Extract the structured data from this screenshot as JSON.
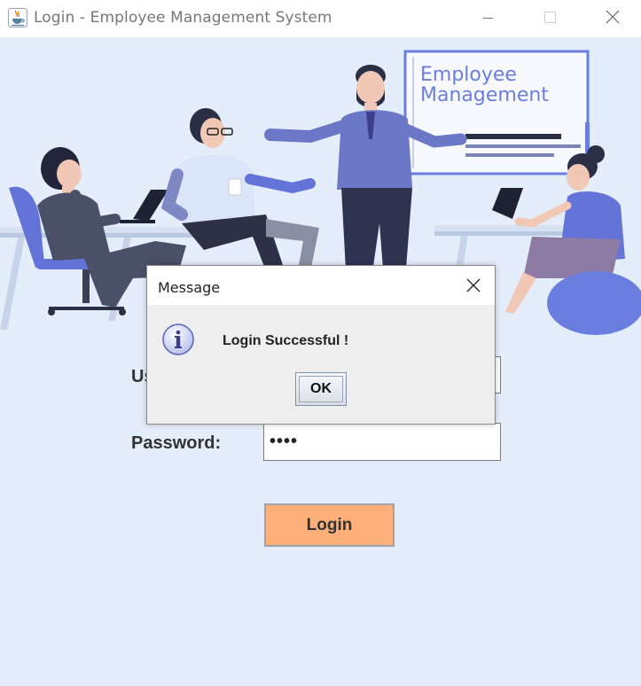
{
  "window": {
    "title": "Login - Employee Management System",
    "icon": "java-cup-icon"
  },
  "illustration": {
    "board_line1": "Employee",
    "board_line2": "Management"
  },
  "form": {
    "username_label": "Username:",
    "password_label": "Password:",
    "username_value": "",
    "password_value": "••••",
    "login_label": "Login"
  },
  "dialog": {
    "title": "Message",
    "message": "Login Successful !",
    "ok_label": "OK",
    "icon": "information-icon"
  },
  "colors": {
    "background": "#e4eefa",
    "login_button": "#ffaf79",
    "accent_blue": "#5a6fd6"
  }
}
